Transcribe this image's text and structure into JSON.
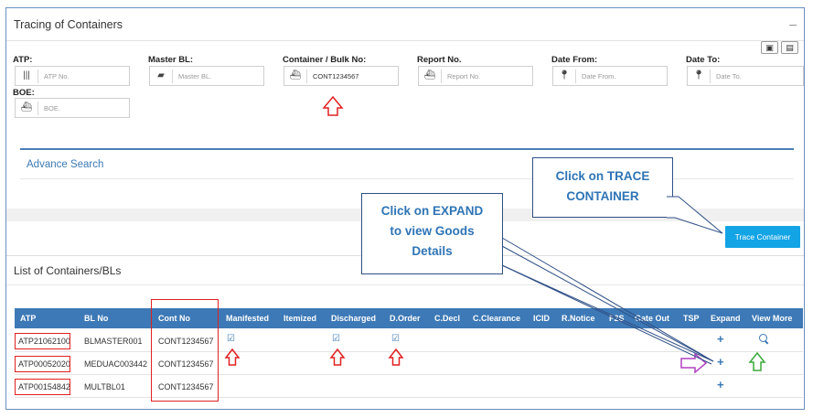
{
  "panel": {
    "title": "Tracing of Containers",
    "minimize_symbol": "–"
  },
  "filters": {
    "atp": {
      "label": "ATP:",
      "placeholder": "ATP No.",
      "icon": "barcode-icon"
    },
    "master_bl": {
      "label": "Master BL:",
      "placeholder": "Master BL.",
      "icon": "folder-open-icon"
    },
    "container": {
      "label": "Container / Bulk No:",
      "value": "CONT1234567",
      "icon": "ship-icon"
    },
    "report": {
      "label": "Report No.",
      "placeholder": "Report No.",
      "icon": "ship-icon"
    },
    "date_from": {
      "label": "Date From:",
      "placeholder": "Date From.",
      "icon": "map-pin-icon"
    },
    "date_to": {
      "label": "Date To:",
      "placeholder": "Date To.",
      "icon": "map-pin-icon"
    },
    "boe": {
      "label": "BOE:",
      "placeholder": "BOE.",
      "icon": "ship-icon"
    }
  },
  "advance_search": {
    "title": "Advance Search"
  },
  "trace_button": {
    "label": "Trace Container"
  },
  "list": {
    "title": "List of Containers/BLs",
    "columns": [
      "ATP",
      "BL No",
      "Cont No",
      "Manifested",
      "Itemized",
      "Discharged",
      "D.Order",
      "C.Decl",
      "C.Clearance",
      "ICID",
      "R.Notice",
      "F2S",
      "Gate Out",
      "TSP",
      "Expand",
      "View More"
    ],
    "rows": [
      {
        "atp": "ATP21062100",
        "bl_no": "BLMASTER001",
        "cont_no": "CONT1234567",
        "manifested": true,
        "discharged": true,
        "d_order": true,
        "view_more": true
      },
      {
        "atp": "ATP00052020",
        "bl_no": "MEDUAC003442",
        "cont_no": "CONT1234567",
        "manifested": false,
        "discharged": false,
        "d_order": false,
        "view_more": false
      },
      {
        "atp": "ATP00154842",
        "bl_no": "MULTBL01",
        "cont_no": "CONT1234567",
        "manifested": false,
        "discharged": false,
        "d_order": false,
        "view_more": false
      }
    ],
    "expand_symbol": "+"
  },
  "callouts": {
    "trace": {
      "line1": "Click on TRACE",
      "line2": "CONTAINER"
    },
    "expand": {
      "line1": "Click on EXPAND",
      "line2": "to view Goods",
      "line3": "Details"
    }
  },
  "colors": {
    "accent": "#3d79b6",
    "button": "#13a4e6",
    "callout_text": "#2e74b5",
    "annotation_red": "#e02020",
    "annotation_purple": "#b040c0",
    "annotation_green": "#3aa83a"
  }
}
